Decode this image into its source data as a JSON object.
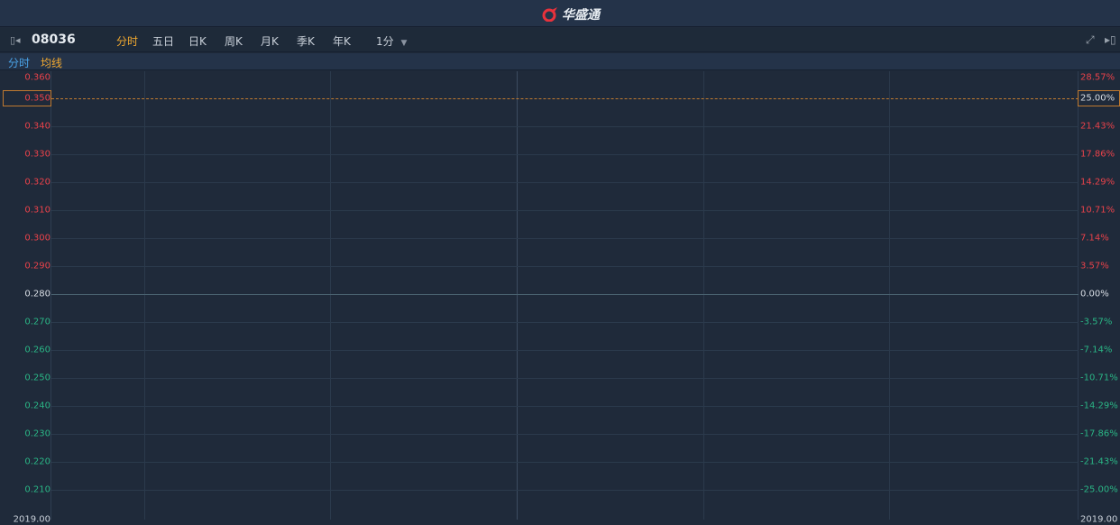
{
  "app": {
    "title": "华盛通"
  },
  "toolbar": {
    "stock_code": "08036",
    "tabs": [
      "分时",
      "五日",
      "日K",
      "周K",
      "月K",
      "季K",
      "年K"
    ],
    "active_tab": 0,
    "interval": "1分"
  },
  "subbar": {
    "label_time": "分时",
    "label_avg": "均线"
  },
  "chart_area": {
    "prev_close": 0.28,
    "price_labels": [
      "0.360",
      "0.350",
      "0.340",
      "0.330",
      "0.320",
      "0.310",
      "0.300",
      "0.290",
      "0.280",
      "0.270",
      "0.260",
      "0.250",
      "0.240",
      "0.230",
      "0.220",
      "0.210"
    ],
    "pct_labels": [
      "28.57%",
      "25.00%",
      "21.43%",
      "17.86%",
      "14.29%",
      "10.71%",
      "7.14%",
      "3.57%",
      "0.00%",
      "-3.57%",
      "-7.14%",
      "-10.71%",
      "-14.29%",
      "-17.86%",
      "-21.43%",
      "-25.00%"
    ],
    "highlight_price": "0.350",
    "highlight_pct": "25.00%",
    "bottom_left": "2019.00",
    "bottom_right": "2019.00",
    "colors": {
      "up": "#e8424a",
      "down": "#2ab585",
      "flat": "#d8dde4",
      "accent": "#f0a830"
    }
  }
}
